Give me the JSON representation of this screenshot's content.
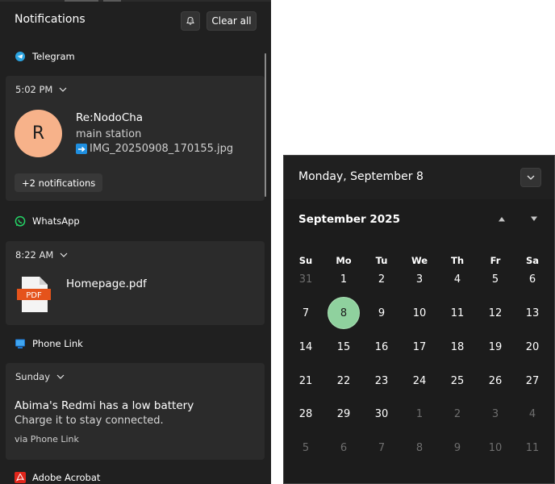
{
  "notifications": {
    "title": "Notifications",
    "clear_all": "Clear all",
    "groups": [
      {
        "app": "Telegram",
        "icon": "telegram-icon",
        "time": "5:02 PM",
        "avatar_letter": "R",
        "sender": "Re:NodoCha",
        "line": "main station",
        "file": "IMG_20250908_170155.jpg",
        "more": "+2 notifications"
      },
      {
        "app": "WhatsApp",
        "icon": "whatsapp-icon",
        "time": "8:22 AM",
        "file_badge": "PDF",
        "file": "Homepage.pdf"
      },
      {
        "app": "Phone Link",
        "icon": "phone-link-icon",
        "time": "Sunday",
        "title": "Abima's Redmi has a low battery",
        "body": "Charge it to stay connected.",
        "via": "via Phone Link"
      },
      {
        "app": "Adobe Acrobat",
        "icon": "acrobat-icon"
      }
    ]
  },
  "calendar": {
    "date_header": "Monday, September 8",
    "month": "September 2025",
    "weekdays": [
      "Su",
      "Mo",
      "Tu",
      "We",
      "Th",
      "Fr",
      "Sa"
    ],
    "today": 8,
    "weeks": [
      [
        {
          "d": "31",
          "cur": false
        },
        {
          "d": "1",
          "cur": true
        },
        {
          "d": "2",
          "cur": true
        },
        {
          "d": "3",
          "cur": true
        },
        {
          "d": "4",
          "cur": true
        },
        {
          "d": "5",
          "cur": true
        },
        {
          "d": "6",
          "cur": true
        }
      ],
      [
        {
          "d": "7",
          "cur": true
        },
        {
          "d": "8",
          "cur": true
        },
        {
          "d": "9",
          "cur": true
        },
        {
          "d": "10",
          "cur": true
        },
        {
          "d": "11",
          "cur": true
        },
        {
          "d": "12",
          "cur": true
        },
        {
          "d": "13",
          "cur": true
        }
      ],
      [
        {
          "d": "14",
          "cur": true
        },
        {
          "d": "15",
          "cur": true
        },
        {
          "d": "16",
          "cur": true
        },
        {
          "d": "17",
          "cur": true
        },
        {
          "d": "18",
          "cur": true
        },
        {
          "d": "19",
          "cur": true
        },
        {
          "d": "20",
          "cur": true
        }
      ],
      [
        {
          "d": "21",
          "cur": true
        },
        {
          "d": "22",
          "cur": true
        },
        {
          "d": "23",
          "cur": true
        },
        {
          "d": "24",
          "cur": true
        },
        {
          "d": "25",
          "cur": true
        },
        {
          "d": "26",
          "cur": true
        },
        {
          "d": "27",
          "cur": true
        }
      ],
      [
        {
          "d": "28",
          "cur": true
        },
        {
          "d": "29",
          "cur": true
        },
        {
          "d": "30",
          "cur": true
        },
        {
          "d": "1",
          "cur": false
        },
        {
          "d": "2",
          "cur": false
        },
        {
          "d": "3",
          "cur": false
        },
        {
          "d": "4",
          "cur": false
        }
      ],
      [
        {
          "d": "5",
          "cur": false
        },
        {
          "d": "6",
          "cur": false
        },
        {
          "d": "7",
          "cur": false
        },
        {
          "d": "8",
          "cur": false
        },
        {
          "d": "9",
          "cur": false
        },
        {
          "d": "10",
          "cur": false
        },
        {
          "d": "11",
          "cur": false
        }
      ]
    ]
  },
  "colors": {
    "panel_bg": "#202020",
    "card_bg": "#2b2b2b",
    "today_highlight": "#8fd19e",
    "telegram": "#2aa3e0",
    "whatsapp": "#25d366",
    "acrobat": "#e0261b",
    "pdf_badge": "#e5531b"
  }
}
